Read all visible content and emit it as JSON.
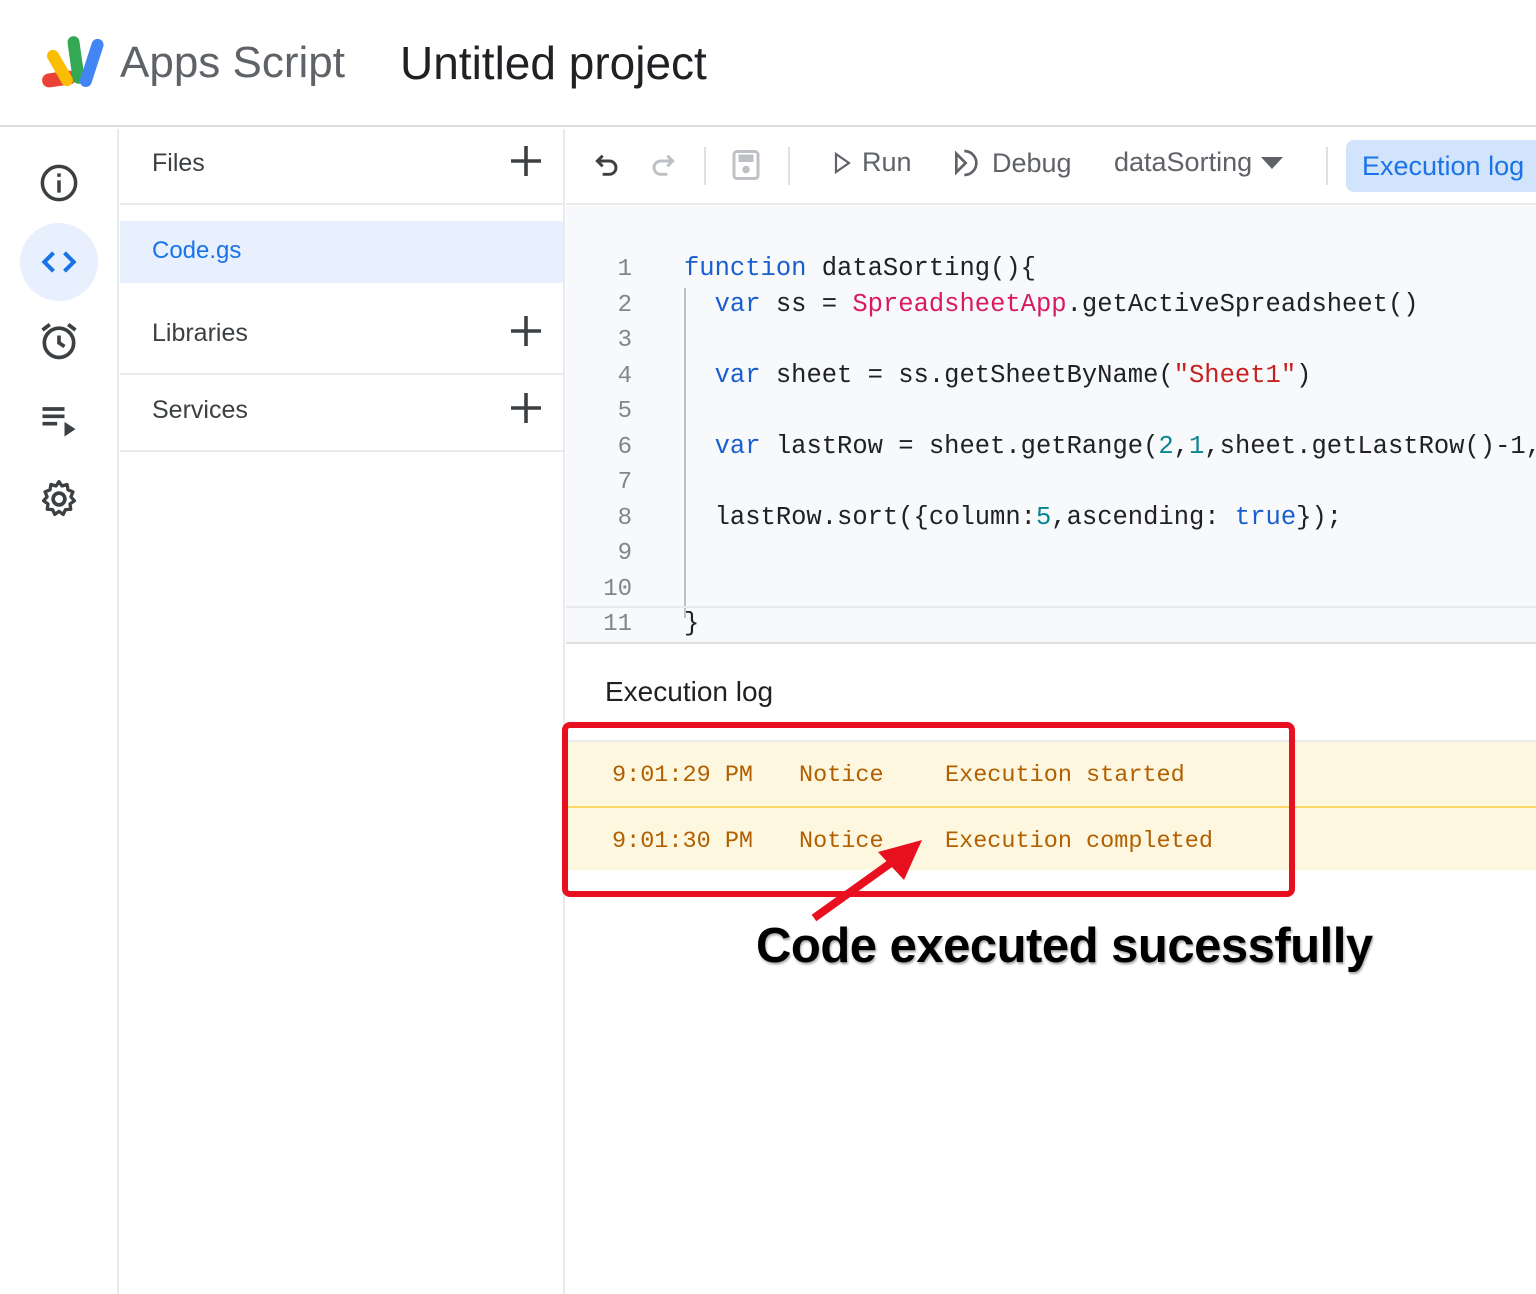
{
  "header": {
    "app_name": "Apps Script",
    "project_title": "Untitled project"
  },
  "rail": {
    "items": [
      {
        "icon": "info-icon",
        "label": "Overview"
      },
      {
        "icon": "code-icon",
        "label": "Editor",
        "active": true
      },
      {
        "icon": "alarm-clock-icon",
        "label": "Triggers"
      },
      {
        "icon": "executions-icon",
        "label": "Executions"
      },
      {
        "icon": "gear-icon",
        "label": "Project Settings"
      }
    ]
  },
  "files": {
    "files_label": "Files",
    "file_name": "Code.gs",
    "libraries_label": "Libraries",
    "services_label": "Services"
  },
  "toolbar": {
    "run_label": "Run",
    "debug_label": "Debug",
    "function_select": "dataSorting",
    "exec_log_label": "Execution log"
  },
  "editor": {
    "lines": [
      [
        [
          "kw",
          "function"
        ],
        [
          "p",
          " dataSorting(){"
        ]
      ],
      [
        [
          "p",
          "  "
        ],
        [
          "kw",
          "var"
        ],
        [
          "p",
          " ss = "
        ],
        [
          "cls",
          "SpreadsheetApp"
        ],
        [
          "p",
          ".getActiveSpreadsheet()"
        ]
      ],
      [],
      [
        [
          "p",
          "  "
        ],
        [
          "kw",
          "var"
        ],
        [
          "p",
          " sheet = ss.getSheetByName("
        ],
        [
          "str",
          "\"Sheet1\""
        ],
        [
          "p",
          ")"
        ]
      ],
      [],
      [
        [
          "p",
          "  "
        ],
        [
          "kw",
          "var"
        ],
        [
          "p",
          " lastRow = sheet.getRange("
        ],
        [
          "num",
          "2"
        ],
        [
          "p",
          ","
        ],
        [
          "num",
          "1"
        ],
        [
          "p",
          ",sheet.getLastRow()-1,"
        ]
      ],
      [],
      [
        [
          "p",
          "  lastRow.sort({column:"
        ],
        [
          "num",
          "5"
        ],
        [
          "p",
          ",ascending: "
        ],
        [
          "bool",
          "true"
        ],
        [
          "p",
          "});"
        ]
      ],
      [],
      [],
      [
        [
          "p",
          "}"
        ]
      ]
    ]
  },
  "log": {
    "title": "Execution log",
    "rows": [
      {
        "time": "9:01:29 PM",
        "level": "Notice",
        "message": "Execution started"
      },
      {
        "time": "9:01:30 PM",
        "level": "Notice",
        "message": "Execution completed"
      }
    ]
  },
  "annotation": {
    "text": "Code executed sucessfully",
    "color": "#e8101e"
  },
  "colors": {
    "accent": "#1a73e8",
    "log_bg": "#fef7e0",
    "log_text": "#b06000"
  }
}
